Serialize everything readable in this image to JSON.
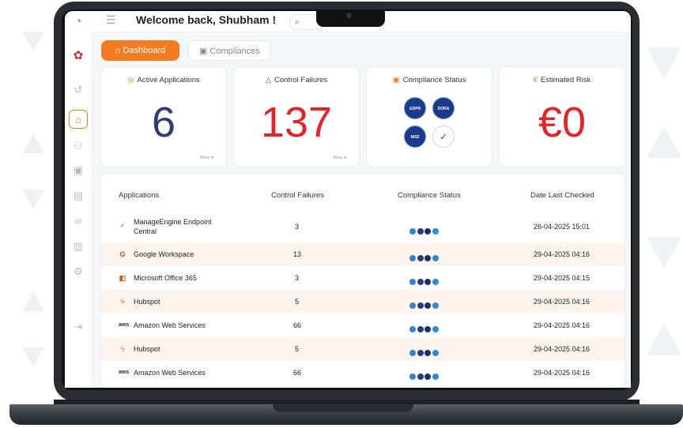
{
  "header": {
    "welcome": "Welcome back, Shubham !"
  },
  "tabs": [
    {
      "label": "Dashboard",
      "active": true
    },
    {
      "label": "Compliances",
      "active": false
    }
  ],
  "cards": {
    "active_apps": {
      "title": "Active Applications",
      "value": "6",
      "more": "More ▾",
      "color": "#2f3a7a"
    },
    "control_failures": {
      "title": "Control Failures",
      "value": "137",
      "more": "More ▾",
      "color": "#e4232a"
    },
    "compliance_status": {
      "title": "Compliance Status",
      "badges": [
        "GDPR",
        "DORA",
        "NIS2",
        "✓"
      ]
    },
    "estimated_risk": {
      "title": "Estimated Risk",
      "value": "€0",
      "color": "#e4232a"
    }
  },
  "table": {
    "headers": [
      "Applications",
      "Control Failures",
      "Compliance Status",
      "Date Last Checked"
    ],
    "rows": [
      {
        "app": "ManageEngine Endpoint Central",
        "icon": "manageengine-icon",
        "failures": "3",
        "date": "26-04-2025 15:01"
      },
      {
        "app": "Google Workspace",
        "icon": "google-icon",
        "failures": "13",
        "date": "29-04-2025 04:16"
      },
      {
        "app": "Microsoft Office 365",
        "icon": "office-icon",
        "failures": "3",
        "date": "29-04-2025 04:15"
      },
      {
        "app": "Hubspot",
        "icon": "hubspot-icon",
        "failures": "5",
        "date": "29-04-2025 04:16"
      },
      {
        "app": "Amazon Web Services",
        "icon": "aws-icon",
        "failures": "66",
        "date": "29-04-2025 04:16"
      },
      {
        "app": "Hubspot",
        "icon": "hubspot-icon",
        "failures": "5",
        "date": "29-04-2025 04:16"
      },
      {
        "app": "Amazon Web Services",
        "icon": "aws-icon",
        "failures": "66",
        "date": "29-04-2025 04:16"
      }
    ]
  },
  "colors": {
    "accent": "#f37b21",
    "navy": "#2f3a7a",
    "red": "#e4232a"
  }
}
